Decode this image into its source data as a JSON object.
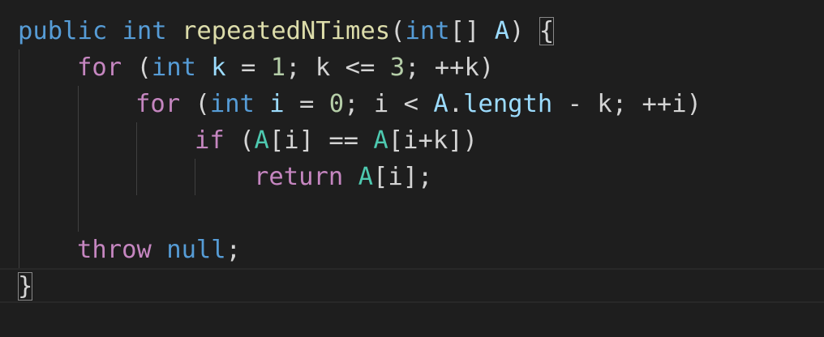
{
  "editor": {
    "colors": {
      "background": "#1e1e1e",
      "control_keyword": "#c586c0",
      "type_keyword": "#569cd6",
      "function": "#dcdcaa",
      "variable": "#9cdcfe",
      "param": "#4ec9b0",
      "number": "#b5cea8",
      "plain": "#d4d4d4"
    },
    "lines": [
      {
        "tokens": [
          "public",
          " ",
          "int",
          " ",
          "repeatedNTimes",
          "(",
          "int",
          "[]",
          " ",
          "A",
          ")",
          " ",
          "{"
        ]
      },
      {
        "tokens": [
          "for",
          " (",
          "int",
          " ",
          "k",
          " = ",
          "1",
          "; ",
          "k",
          " <= ",
          "3",
          "; ++",
          "k",
          ")"
        ]
      },
      {
        "tokens": [
          "for",
          " (",
          "int",
          " ",
          "i",
          " = ",
          "0",
          "; ",
          "i",
          " < ",
          "A",
          ".",
          "length",
          " - ",
          "k",
          "; ++",
          "i",
          ")"
        ]
      },
      {
        "tokens": [
          "if",
          " (",
          "A",
          "[",
          "i",
          "] == ",
          "A",
          "[",
          "i",
          "+",
          "k",
          "])"
        ]
      },
      {
        "tokens": [
          "return",
          " ",
          "A",
          "[",
          "i",
          "];"
        ]
      },
      {
        "tokens": []
      },
      {
        "tokens": [
          "throw",
          " ",
          "null",
          ";"
        ]
      },
      {
        "tokens": [
          "}"
        ]
      }
    ]
  }
}
